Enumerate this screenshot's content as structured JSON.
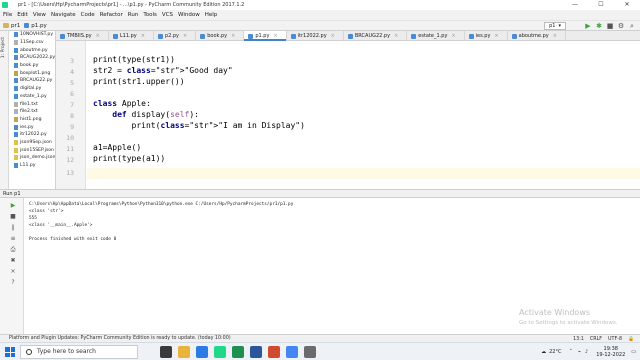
{
  "window": {
    "title": "pr1 - [C:\\Users\\Hp\\PycharmProjects\\pr1] - ...\\p1.py - PyCharm Community Edition 2017.1.2",
    "controls": [
      "—",
      "☐",
      "✕"
    ]
  },
  "menu": [
    "File",
    "Edit",
    "View",
    "Navigate",
    "Code",
    "Refactor",
    "Run",
    "Tools",
    "VCS",
    "Window",
    "Help"
  ],
  "breadcrumb": {
    "project": "pr1",
    "file": "p1.py"
  },
  "run_config": "p1",
  "left_strip_label": "1: Project",
  "project_files": [
    {
      "name": "10NOVHIST.py",
      "type": "py"
    },
    {
      "name": "11Sep.csv",
      "type": "txt"
    },
    {
      "name": "aboutme.py",
      "type": "py"
    },
    {
      "name": "BCAUG2022.py",
      "type": "py"
    },
    {
      "name": "book.py",
      "type": "py"
    },
    {
      "name": "boxplot1.png",
      "type": "img"
    },
    {
      "name": "BRCAUG22.py",
      "type": "py"
    },
    {
      "name": "digital.py",
      "type": "py"
    },
    {
      "name": "estate_1.py",
      "type": "py"
    },
    {
      "name": "file1.txt",
      "type": "txt"
    },
    {
      "name": "file2.txt",
      "type": "txt"
    },
    {
      "name": "hist1.png",
      "type": "img"
    },
    {
      "name": "ies.py",
      "type": "py"
    },
    {
      "name": "itr12022.py",
      "type": "py"
    },
    {
      "name": "json9Sep.json",
      "type": "js"
    },
    {
      "name": "json15SEP.json",
      "type": "js"
    },
    {
      "name": "json_demo.json",
      "type": "js"
    },
    {
      "name": "L11.py",
      "type": "py"
    }
  ],
  "tabs": [
    {
      "label": "TMBIIS.py",
      "active": false
    },
    {
      "label": "L11.py",
      "active": false
    },
    {
      "label": "p2.py",
      "active": false
    },
    {
      "label": "book.py",
      "active": false
    },
    {
      "label": "p1.py",
      "active": true
    },
    {
      "label": "itr12022.py",
      "active": false
    },
    {
      "label": "BRCAUG22.py",
      "active": false
    },
    {
      "label": "estate_1.py",
      "active": false
    },
    {
      "label": "ies.py",
      "active": false
    },
    {
      "label": "aboutme.py",
      "active": false
    }
  ],
  "code": [
    {
      "n": "3",
      "text": "print(type(str1))"
    },
    {
      "n": "4",
      "text": "str2 = \"Good day\""
    },
    {
      "n": "5",
      "text": "print(str1.upper())"
    },
    {
      "n": "6",
      "text": ""
    },
    {
      "n": "7",
      "text": "class Apple:"
    },
    {
      "n": "8",
      "text": "    def display(self):"
    },
    {
      "n": "9",
      "text": "        print(\"I am in Display\")"
    },
    {
      "n": "10",
      "text": ""
    },
    {
      "n": "11",
      "text": "a1=Apple()"
    },
    {
      "n": "12",
      "text": "print(type(a1))"
    },
    {
      "n": "13",
      "text": ""
    }
  ],
  "run_tab_label": "Run  p1",
  "console": [
    "C:\\Users\\Hp\\AppData\\Local\\Programs\\Python\\Python310\\python.exe C:/Users/Hp/PycharmProjects/pr1/p1.py",
    "<class 'str'>",
    "555",
    "<class '__main__.Apple'>",
    "",
    "Process finished with exit code 0"
  ],
  "watermark": {
    "title": "Activate Windows",
    "subtitle": "Go to Settings to activate Windows."
  },
  "status": {
    "message": "Platform and Plugin Updates: PyCharm Community Edition is ready to update. (today 10:00)",
    "position": "13:1",
    "line_sep": "CRLF",
    "encoding": "UTF-8"
  },
  "taskbar": {
    "search_placeholder": "Type here to search",
    "temperature": "22°C",
    "time": "19:38",
    "date": "19-12-2022"
  },
  "colors": {
    "accent": "#4083c9",
    "keyword": "#000080",
    "string": "#008000"
  }
}
